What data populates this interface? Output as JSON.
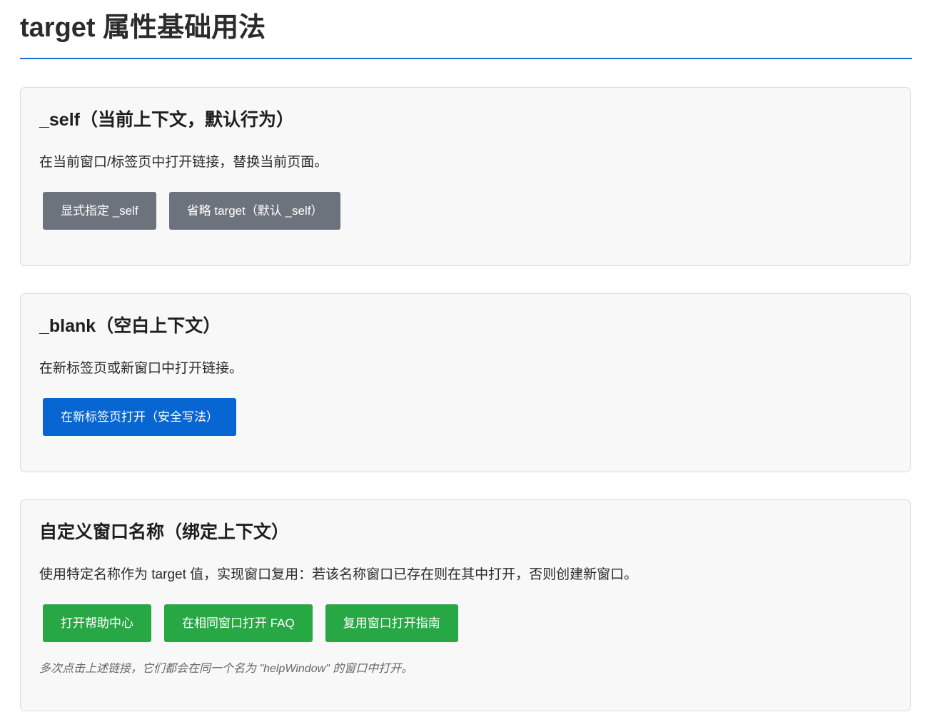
{
  "page": {
    "title": "target 属性基础用法"
  },
  "sections": [
    {
      "title": "_self（当前上下文，默认行为）",
      "description": "在当前窗口/标签页中打开链接，替换当前页面。",
      "buttons": [
        {
          "label": "显式指定 _self",
          "color": "#6c737c"
        },
        {
          "label": "省略 target（默认 _self）",
          "color": "#6c737c"
        }
      ]
    },
    {
      "title": "_blank（空白上下文）",
      "description": "在新标签页或新窗口中打开链接。",
      "buttons": [
        {
          "label": "在新标签页打开（安全写法）",
          "color": "#0766d1"
        }
      ]
    },
    {
      "title": "自定义窗口名称（绑定上下文）",
      "description": "使用特定名称作为 target 值，实现窗口复用：若该名称窗口已存在则在其中打开，否则创建新窗口。",
      "buttons": [
        {
          "label": "打开帮助中心",
          "color": "#28a745"
        },
        {
          "label": "在相同窗口打开 FAQ",
          "color": "#28a745"
        },
        {
          "label": "复用窗口打开指南",
          "color": "#28a745"
        }
      ],
      "note": "多次点击上述链接，它们都会在同一个名为 \"helpWindow\" 的窗口中打开。"
    }
  ],
  "colors": {
    "accent_rule": "#1a6fcf",
    "section_bg": "#f8f8f8",
    "section_border": "#dcdcdc"
  }
}
